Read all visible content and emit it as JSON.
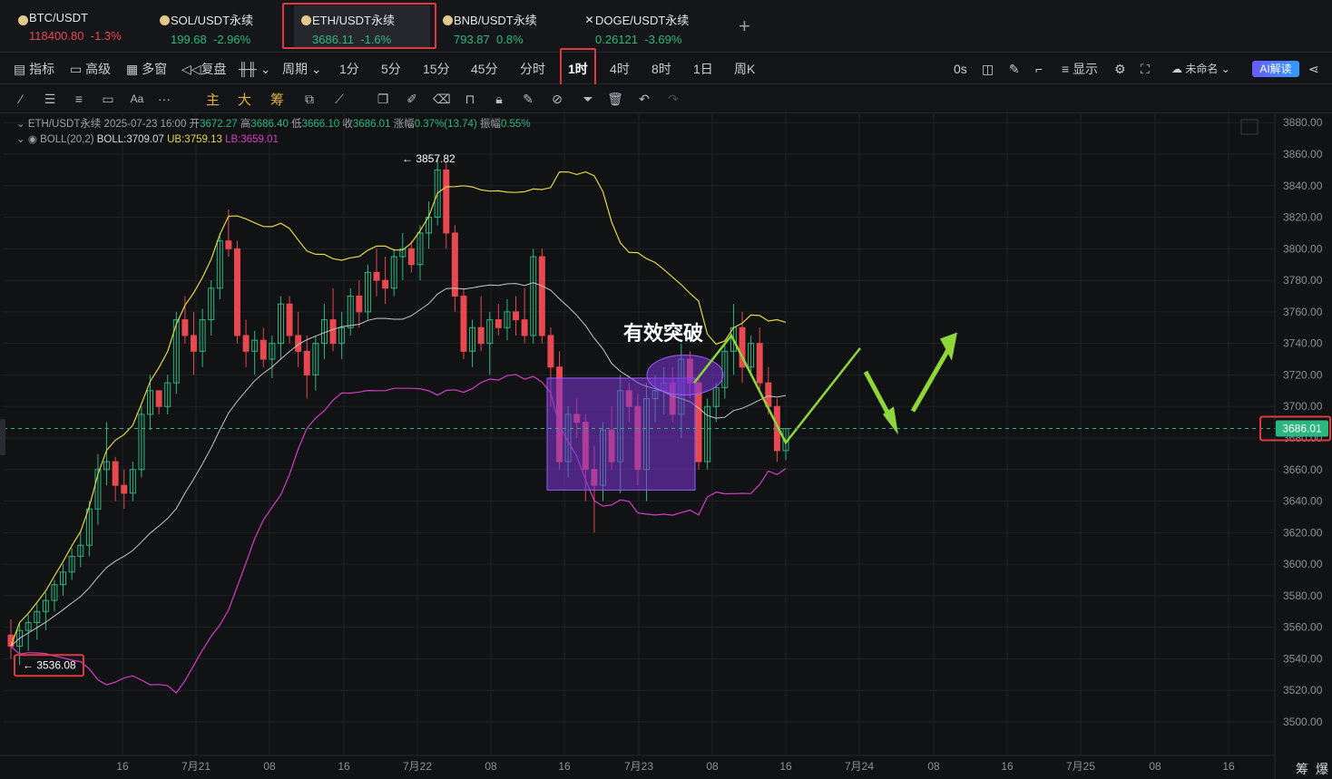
{
  "tabs": [
    {
      "name": "BTC/USDT",
      "price": "118400.80",
      "change": "-1.3%",
      "dir": "down"
    },
    {
      "name": "SOL/USDT永续",
      "price": "199.68",
      "change": "-2.96%",
      "dir": "up"
    },
    {
      "name": "ETH/USDT永续",
      "price": "3686.11",
      "change": "-1.6%",
      "dir": "up"
    },
    {
      "name": "BNB/USDT永续",
      "price": "793.87",
      "change": "0.8%",
      "dir": "up"
    },
    {
      "name": "DOGE/USDT永续",
      "price": "0.26121",
      "change": "-3.69%",
      "dir": "up"
    }
  ],
  "add_tab": "+",
  "toolbar": {
    "indicators": "指标",
    "advanced": "高级",
    "multi_window": "多窗",
    "replay": "复盘",
    "period": "周期",
    "intervals": [
      "1分",
      "5分",
      "15分",
      "45分",
      "分时",
      "1时",
      "4时",
      "8时",
      "1日",
      "周K"
    ],
    "selected_interval": "1时",
    "countdown": "0s",
    "display": "显示",
    "layout_name": "未命名",
    "ai": "AI解读"
  },
  "drawbar": {
    "modes": [
      "主",
      "大",
      "筹"
    ]
  },
  "legend": {
    "symbol": "ETH/USDT永续",
    "datetime": "2025-07-23 16:00",
    "open_label": "开",
    "open": "3672.27",
    "high_label": "高",
    "high": "3686.40",
    "low_label": "低",
    "low": "3666.10",
    "close_label": "收",
    "close": "3686.01",
    "change_label": "涨幅",
    "change": "0.37%(13.74)",
    "amp_label": "振幅",
    "amp": "0.55%",
    "boll_name": "BOLL(20,2)",
    "boll": "BOLL:3709.07",
    "ub": "UB:3759.13",
    "lb": "LB:3659.01"
  },
  "annotations": {
    "breakout": "有效突破",
    "max_price": "3857.82",
    "min_price": "3536.08",
    "current_price": "3686.01"
  },
  "bottom_right": {
    "chip": "筹",
    "liq": "爆"
  },
  "colors": {
    "up": "#2db780",
    "down": "#e8484f",
    "ub": "#e3d64a",
    "mid": "#c8c8c8",
    "lb": "#d63dc7",
    "box": "#7b35d6",
    "arrow": "#8ed63a"
  },
  "chart_data": {
    "type": "candlestick",
    "symbol": "ETH/USDT永续",
    "interval": "1时",
    "ylim": [
      3490,
      3885
    ],
    "y_ticks": [
      "3880.00",
      "3860.00",
      "3840.00",
      "3820.00",
      "3800.00",
      "3780.00",
      "3760.00",
      "3740.00",
      "3720.00",
      "3700.00",
      "3680.00",
      "3660.00",
      "3640.00",
      "3620.00",
      "3600.00",
      "3580.00",
      "3560.00",
      "3540.00",
      "3520.00",
      "3500.00"
    ],
    "x_ticks": [
      "16",
      "7月21",
      "08",
      "16",
      "7月22",
      "08",
      "16",
      "7月23",
      "08",
      "16",
      "7月24",
      "08",
      "16",
      "7月25",
      "08",
      "16"
    ],
    "candles": [
      [
        3555,
        3565,
        3540,
        3548
      ],
      [
        3548,
        3562,
        3536,
        3558
      ],
      [
        3558,
        3568,
        3545,
        3563
      ],
      [
        3563,
        3575,
        3552,
        3570
      ],
      [
        3570,
        3582,
        3558,
        3577
      ],
      [
        3577,
        3590,
        3570,
        3587
      ],
      [
        3587,
        3600,
        3580,
        3595
      ],
      [
        3595,
        3610,
        3590,
        3605
      ],
      [
        3605,
        3620,
        3598,
        3612
      ],
      [
        3612,
        3640,
        3605,
        3635
      ],
      [
        3635,
        3670,
        3625,
        3660
      ],
      [
        3660,
        3690,
        3650,
        3665
      ],
      [
        3665,
        3668,
        3640,
        3650
      ],
      [
        3650,
        3660,
        3635,
        3645
      ],
      [
        3645,
        3665,
        3640,
        3660
      ],
      [
        3660,
        3700,
        3655,
        3695
      ],
      [
        3695,
        3720,
        3685,
        3710
      ],
      [
        3710,
        3705,
        3695,
        3700
      ],
      [
        3700,
        3720,
        3695,
        3715
      ],
      [
        3715,
        3760,
        3708,
        3755
      ],
      [
        3755,
        3770,
        3740,
        3745
      ],
      [
        3745,
        3760,
        3720,
        3735
      ],
      [
        3735,
        3762,
        3725,
        3755
      ],
      [
        3755,
        3780,
        3745,
        3775
      ],
      [
        3775,
        3810,
        3768,
        3805
      ],
      [
        3805,
        3825,
        3795,
        3800
      ],
      [
        3800,
        3805,
        3740,
        3745
      ],
      [
        3745,
        3755,
        3725,
        3735
      ],
      [
        3735,
        3748,
        3720,
        3742
      ],
      [
        3742,
        3750,
        3725,
        3730
      ],
      [
        3730,
        3745,
        3718,
        3740
      ],
      [
        3740,
        3770,
        3730,
        3765
      ],
      [
        3765,
        3770,
        3740,
        3745
      ],
      [
        3745,
        3760,
        3725,
        3735
      ],
      [
        3735,
        3745,
        3705,
        3720
      ],
      [
        3720,
        3745,
        3710,
        3740
      ],
      [
        3740,
        3765,
        3730,
        3755
      ],
      [
        3755,
        3775,
        3735,
        3740
      ],
      [
        3740,
        3760,
        3730,
        3750
      ],
      [
        3750,
        3775,
        3745,
        3770
      ],
      [
        3770,
        3780,
        3750,
        3760
      ],
      [
        3760,
        3790,
        3755,
        3785
      ],
      [
        3785,
        3800,
        3770,
        3780
      ],
      [
        3780,
        3795,
        3765,
        3775
      ],
      [
        3775,
        3800,
        3770,
        3795
      ],
      [
        3795,
        3810,
        3780,
        3800
      ],
      [
        3800,
        3805,
        3785,
        3790
      ],
      [
        3790,
        3815,
        3780,
        3810
      ],
      [
        3810,
        3830,
        3800,
        3820
      ],
      [
        3820,
        3858,
        3815,
        3850
      ],
      [
        3850,
        3855,
        3800,
        3810
      ],
      [
        3810,
        3815,
        3760,
        3770
      ],
      [
        3770,
        3775,
        3730,
        3735
      ],
      [
        3735,
        3755,
        3725,
        3750
      ],
      [
        3750,
        3770,
        3735,
        3740
      ],
      [
        3740,
        3760,
        3720,
        3755
      ],
      [
        3755,
        3765,
        3745,
        3750
      ],
      [
        3750,
        3768,
        3742,
        3760
      ],
      [
        3760,
        3770,
        3745,
        3755
      ],
      [
        3755,
        3775,
        3740,
        3745
      ],
      [
        3745,
        3800,
        3740,
        3795
      ],
      [
        3795,
        3800,
        3740,
        3745
      ],
      [
        3745,
        3750,
        3700,
        3725
      ],
      [
        3725,
        3735,
        3660,
        3665
      ],
      [
        3665,
        3700,
        3655,
        3695
      ],
      [
        3695,
        3705,
        3680,
        3690
      ],
      [
        3690,
        3695,
        3640,
        3660
      ],
      [
        3660,
        3675,
        3620,
        3650
      ],
      [
        3650,
        3690,
        3640,
        3685
      ],
      [
        3685,
        3700,
        3660,
        3665
      ],
      [
        3665,
        3720,
        3645,
        3710
      ],
      [
        3710,
        3715,
        3690,
        3700
      ],
      [
        3700,
        3708,
        3650,
        3660
      ],
      [
        3660,
        3715,
        3640,
        3705
      ],
      [
        3705,
        3720,
        3690,
        3710
      ],
      [
        3710,
        3725,
        3695,
        3715
      ],
      [
        3715,
        3725,
        3690,
        3695
      ],
      [
        3695,
        3740,
        3680,
        3730
      ],
      [
        3730,
        3735,
        3705,
        3715
      ],
      [
        3715,
        3720,
        3660,
        3665
      ],
      [
        3665,
        3705,
        3660,
        3700
      ],
      [
        3700,
        3715,
        3690,
        3712
      ],
      [
        3712,
        3740,
        3705,
        3735
      ],
      [
        3735,
        3765,
        3720,
        3750
      ],
      [
        3750,
        3760,
        3715,
        3725
      ],
      [
        3725,
        3745,
        3720,
        3740
      ],
      [
        3740,
        3750,
        3710,
        3715
      ],
      [
        3715,
        3725,
        3695,
        3700
      ],
      [
        3700,
        3705,
        3665,
        3672
      ],
      [
        3672,
        3686,
        3666,
        3686
      ]
    ],
    "boll": {
      "period": 20,
      "mult": 2,
      "ub_last": 3759.13,
      "mid_last": 3709.07,
      "lb_last": 3659.01
    },
    "highest": 3857.82,
    "lowest": 3536.08,
    "last": 3686.01
  }
}
